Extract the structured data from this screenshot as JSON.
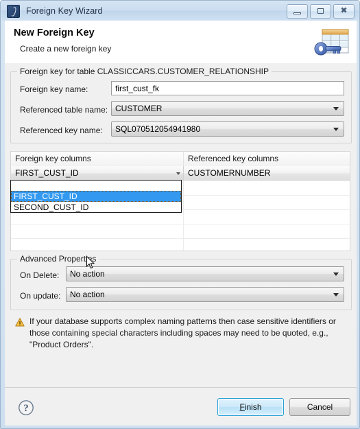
{
  "window": {
    "title": "Foreign Key Wizard",
    "app_icon": "sql-script-icon",
    "controls": {
      "minimize": "minimize-icon",
      "restore": "restore-icon",
      "close": "close-icon"
    }
  },
  "header": {
    "title": "New Foreign Key",
    "subtitle": "Create a new foreign key",
    "icon": "table-key-icon"
  },
  "foreign_key_group": {
    "legend": "Foreign key for table CLASSICCARS.CUSTOMER_RELATIONSHIP",
    "fields": [
      {
        "label": "Foreign key name:",
        "value": "first_cust_fk",
        "type": "text"
      },
      {
        "label": "Referenced table name:",
        "value": "CUSTOMER",
        "type": "combo"
      },
      {
        "label": "Referenced key name:",
        "value": "SQL070512054941980",
        "type": "combo"
      }
    ]
  },
  "columns_grid": {
    "headers": [
      "Foreign key columns",
      "Referenced key columns"
    ],
    "rows": [
      {
        "fk": "FIRST_CUST_ID",
        "ref": "CUSTOMERNUMBER"
      },
      {
        "fk": "",
        "ref": ""
      },
      {
        "fk": "",
        "ref": ""
      },
      {
        "fk": "",
        "ref": ""
      },
      {
        "fk": "",
        "ref": ""
      },
      {
        "fk": "",
        "ref": ""
      }
    ]
  },
  "dropdown": {
    "open": true,
    "options": [
      "",
      "FIRST_CUST_ID",
      "SECOND_CUST_ID"
    ],
    "selected": "FIRST_CUST_ID",
    "highlight_color": "#3399f0"
  },
  "advanced_properties": {
    "legend": "Advanced Properties",
    "fields": [
      {
        "label": "On Delete:",
        "value": "No action"
      },
      {
        "label": "On update:",
        "value": "No action"
      }
    ]
  },
  "warning": {
    "icon": "warning-triangle-icon",
    "text": "If your database supports complex naming patterns then case sensitive identifiers or those containing special characters including spaces may need to be quoted, e.g., \"Product Orders\"."
  },
  "footer": {
    "help_icon": "help-question-icon",
    "finish_mnemonic": "F",
    "finish_rest": "inish",
    "cancel_label": "Cancel"
  }
}
